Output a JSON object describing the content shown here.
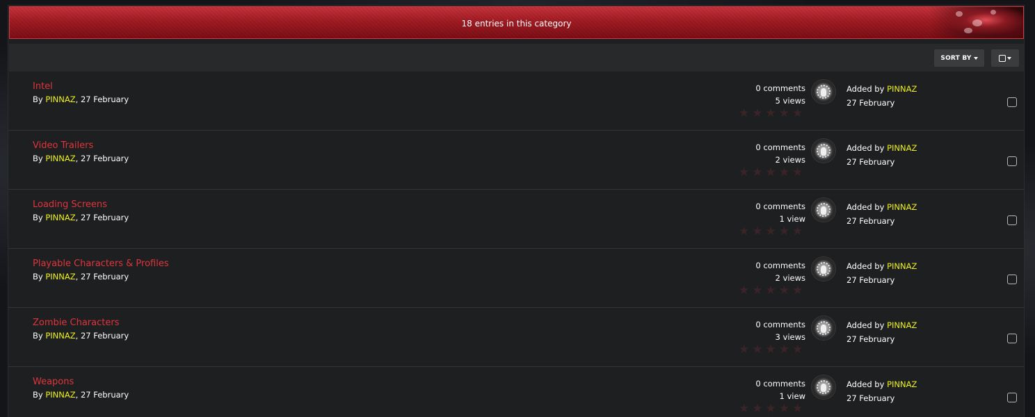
{
  "header": {
    "title": "18 entries in this category"
  },
  "toolbar": {
    "sort_label": "SORT BY",
    "select_icon": "checkbox-square-icon"
  },
  "colors": {
    "accent": "#e0353d",
    "username": "#eef221",
    "header_red": "#a41c24",
    "panel_bg": "#1e1f20"
  },
  "entries": [
    {
      "title": "Intel",
      "by_prefix": "By ",
      "author": "PINNAZ",
      "date": ", 27 February",
      "comments": "0 comments",
      "views": "5 views",
      "added_prefix": "Added by ",
      "added_by": "PINNAZ",
      "added_date": "27 February",
      "rating": 0
    },
    {
      "title": "Video Trailers",
      "by_prefix": "By ",
      "author": "PINNAZ",
      "date": ", 27 February",
      "comments": "0 comments",
      "views": "2 views",
      "added_prefix": "Added by ",
      "added_by": "PINNAZ",
      "added_date": "27 February",
      "rating": 0
    },
    {
      "title": "Loading Screens",
      "by_prefix": "By ",
      "author": "PINNAZ",
      "date": ", 27 February",
      "comments": "0 comments",
      "views": "1 view",
      "added_prefix": "Added by ",
      "added_by": "PINNAZ",
      "added_date": "27 February",
      "rating": 0
    },
    {
      "title": "Playable Characters & Profiles",
      "by_prefix": "By ",
      "author": "PINNAZ",
      "date": ", 27 February",
      "comments": "0 comments",
      "views": "2 views",
      "added_prefix": "Added by ",
      "added_by": "PINNAZ",
      "added_date": "27 February",
      "rating": 0
    },
    {
      "title": "Zombie Characters",
      "by_prefix": "By ",
      "author": "PINNAZ",
      "date": ", 27 February",
      "comments": "0 comments",
      "views": "3 views",
      "added_prefix": "Added by ",
      "added_by": "PINNAZ",
      "added_date": "27 February",
      "rating": 0
    },
    {
      "title": "Weapons",
      "by_prefix": "By ",
      "author": "PINNAZ",
      "date": ", 27 February",
      "comments": "0 comments",
      "views": "1 view",
      "added_prefix": "Added by ",
      "added_by": "PINNAZ",
      "added_date": "27 February",
      "rating": 0
    }
  ]
}
